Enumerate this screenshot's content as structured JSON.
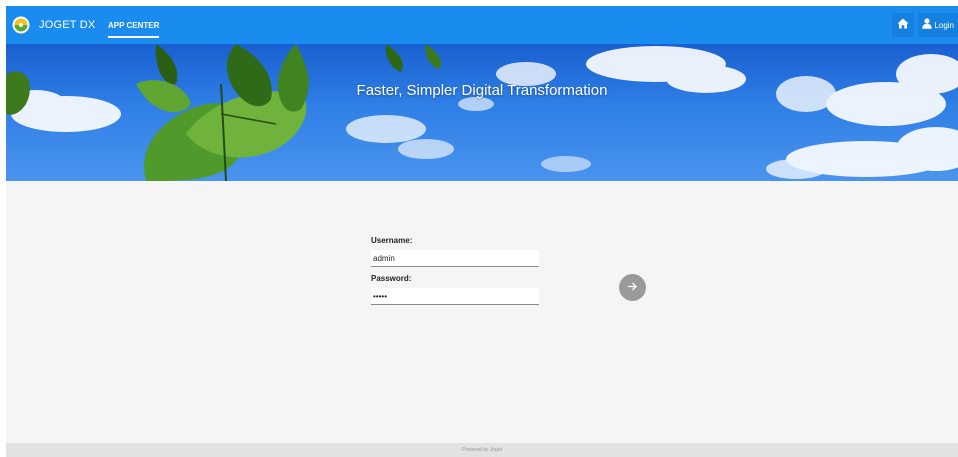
{
  "header": {
    "brand_name": "JOGET DX",
    "nav_tab_label": "APP CENTER",
    "home_icon": "home-icon",
    "login_label": "Login",
    "login_icon": "user-icon",
    "bar_color": "#1a8cf0"
  },
  "banner": {
    "title": "Faster, Simpler Digital Transformation"
  },
  "login_form": {
    "username_label": "Username:",
    "username_value": "admin",
    "password_label": "Password:",
    "password_value": "admin",
    "submit_icon": "arrow-right-icon"
  },
  "footer": {
    "text": "Powered by Joget"
  }
}
